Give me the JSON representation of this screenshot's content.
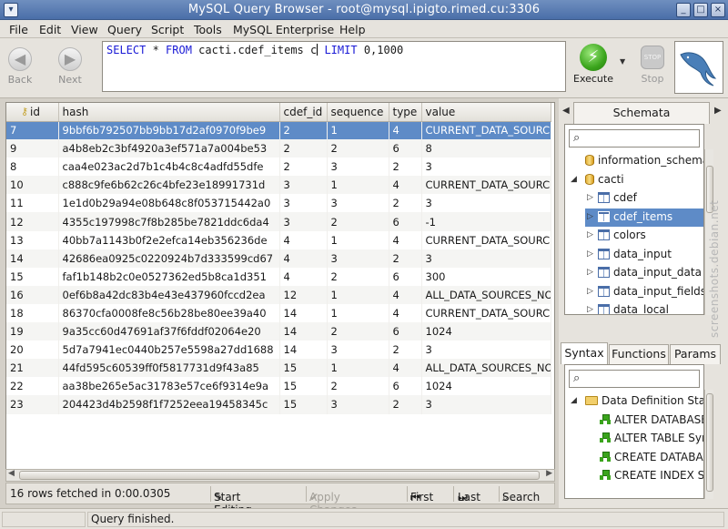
{
  "window": {
    "title": "MySQL Query Browser - root@mysql.ipigto.rimed.cu:3306"
  },
  "menu": [
    "File",
    "Edit",
    "View",
    "Query",
    "Script",
    "Tools",
    "MySQL Enterprise",
    "Help"
  ],
  "toolbar": {
    "back_label": "Back",
    "next_label": "Next",
    "query": {
      "kw_select": "SELECT",
      "star": " * ",
      "kw_from": "FROM",
      "table": " cacti.cdef_items c",
      "kw_limit": " LIMIT",
      "limit": " 0,1000"
    },
    "execute_label": "Execute",
    "stop_label": "Stop",
    "stop_text": "STOP"
  },
  "grid": {
    "columns": [
      "id",
      "hash",
      "cdef_id",
      "sequence",
      "type",
      "value"
    ],
    "rows": [
      [
        "7",
        "9bbf6b792507bb9bb17d2af0970f9be9",
        "2",
        "1",
        "4",
        "CURRENT_DATA_SOURCE"
      ],
      [
        "9",
        "a4b8eb2c3bf4920a3ef571a7a004be53",
        "2",
        "2",
        "6",
        "8"
      ],
      [
        "8",
        "caa4e023ac2d7b1c4b4c8c4adfd55dfe",
        "2",
        "3",
        "2",
        "3"
      ],
      [
        "10",
        "c888c9fe6b62c26c4bfe23e18991731d",
        "3",
        "1",
        "4",
        "CURRENT_DATA_SOURCE"
      ],
      [
        "11",
        "1e1d0b29a94e08b648c8f053715442a0",
        "3",
        "3",
        "2",
        "3"
      ],
      [
        "12",
        "4355c197998c7f8b285be7821ddc6da4",
        "3",
        "2",
        "6",
        "-1"
      ],
      [
        "13",
        "40bb7a1143b0f2e2efca14eb356236de",
        "4",
        "1",
        "4",
        "CURRENT_DATA_SOURCE"
      ],
      [
        "14",
        "42686ea0925c0220924b7d333599cd67",
        "4",
        "3",
        "2",
        "3"
      ],
      [
        "15",
        "faf1b148b2c0e0527362ed5b8ca1d351",
        "4",
        "2",
        "6",
        "300"
      ],
      [
        "16",
        "0ef6b8a42dc83b4e43e437960fccd2ea",
        "12",
        "1",
        "4",
        "ALL_DATA_SOURCES_NODUPS"
      ],
      [
        "18",
        "86370cfa0008fe8c56b28be80ee39a40",
        "14",
        "1",
        "4",
        "CURRENT_DATA_SOURCE"
      ],
      [
        "19",
        "9a35cc60d47691af37f6fddf02064e20",
        "14",
        "2",
        "6",
        "1024"
      ],
      [
        "20",
        "5d7a7941ec0440b257e5598a27dd1688",
        "14",
        "3",
        "2",
        "3"
      ],
      [
        "21",
        "44fd595c60539ff0f5817731d9f43a85",
        "15",
        "1",
        "4",
        "ALL_DATA_SOURCES_NODUPS"
      ],
      [
        "22",
        "aa38be265e5ac31783e57ce6f9314e9a",
        "15",
        "2",
        "6",
        "1024"
      ],
      [
        "23",
        "204423d4b2598f1f7252eea19458345c",
        "15",
        "3",
        "2",
        "3"
      ]
    ],
    "status": "16 rows fetched in 0:00.0305",
    "start_editing": "Start Editing",
    "apply_changes": "Apply Changes",
    "first": "First",
    "last": "Last",
    "search": "Search"
  },
  "statusbar": {
    "message": "Query finished."
  },
  "schemata": {
    "tab_label": "Schemata",
    "items": [
      {
        "label": "information_schema",
        "kind": "db"
      },
      {
        "label": "cacti",
        "kind": "db",
        "expanded": true
      },
      {
        "label": "cdef",
        "kind": "table"
      },
      {
        "label": "cdef_items",
        "kind": "table",
        "selected": true
      },
      {
        "label": "colors",
        "kind": "table"
      },
      {
        "label": "data_input",
        "kind": "table"
      },
      {
        "label": "data_input_data",
        "kind": "table"
      },
      {
        "label": "data_input_fields",
        "kind": "table"
      },
      {
        "label": "data_local",
        "kind": "table"
      }
    ]
  },
  "syntax": {
    "tabs": [
      "Syntax",
      "Functions",
      "Params"
    ],
    "items": [
      {
        "label": "Data Definition Statements",
        "kind": "folder"
      },
      {
        "label": "ALTER DATABASE",
        "kind": "snippet"
      },
      {
        "label": "ALTER TABLE Syntax",
        "kind": "snippet"
      },
      {
        "label": "CREATE DATABASE",
        "kind": "snippet"
      },
      {
        "label": "CREATE INDEX Syntax",
        "kind": "snippet"
      }
    ]
  },
  "watermark": "screenshots.debian.net",
  "colors": {
    "selection": "#5e8bc7",
    "keyword": "#1a1ad6"
  }
}
